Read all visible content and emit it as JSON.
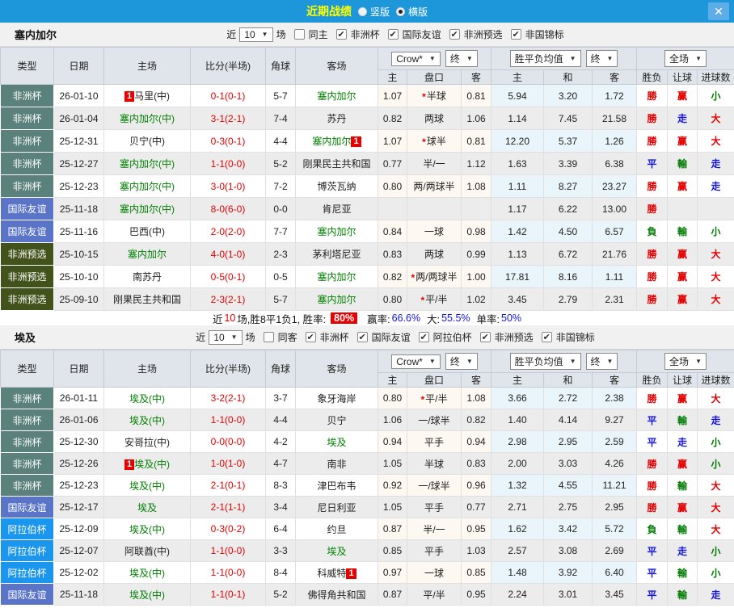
{
  "titlebar": {
    "title": "近期战绩",
    "radio_vertical": "竖版",
    "radio_horizontal": "横版",
    "selected_layout": "横版"
  },
  "icons": {
    "close": "✕",
    "check": "✔",
    "arrow": "▼",
    "star": "*",
    "badge_char": "1"
  },
  "columns": {
    "type": "类型",
    "date": "日期",
    "home": "主场",
    "score": "比分(半场)",
    "corner": "角球",
    "away": "客场",
    "sub": [
      "主",
      "盘口",
      "客",
      "主",
      "和",
      "客",
      "胜负",
      "让球",
      "进球数"
    ]
  },
  "dropdowns": {
    "crow": "Crow*",
    "final": "终",
    "avg": "胜平负均值",
    "full": "全场"
  },
  "type_styles": {
    "非洲杯": "#5a817b",
    "国际友谊": "#5a74c8",
    "非洲预选": "#41531a",
    "阿拉伯杯": "#1b96ee"
  },
  "result_colors": {
    "勝": "#e60000",
    "平": "#1414e6",
    "負": "#007a00",
    "赢": "#e60000",
    "輸": "#007a00",
    "走": "#1414e6",
    "大": "#e60000",
    "小": "#007a00"
  },
  "sections": [
    {
      "team": "塞内加尔",
      "filter": {
        "near": "近",
        "count": "10",
        "games": "场",
        "same_label": "同主",
        "same_checked": false,
        "cups": [
          "非洲杯",
          "国际友谊",
          "非洲预选",
          "非国锦标"
        ]
      },
      "summary": {
        "s1": "近",
        "count": "10",
        "s2": "场,胜8平1负1, 胜率:",
        "rate": "80%",
        "win_label": "赢率:",
        "win": "66.6%",
        "big_label": "大:",
        "big": "55.5%",
        "single_label": "单率:",
        "single": "50%"
      },
      "rows": [
        {
          "type": "非洲杯",
          "date": "26-01-10",
          "home": "马里(中)",
          "home_self": false,
          "home_badge": "pre",
          "score": "0-1(0-1)",
          "corner": "5-7",
          "away": "塞内加尔",
          "away_self": true,
          "o1": "1.07",
          "pk": "半球",
          "pk_star": true,
          "o2": "0.81",
          "a1": "5.94",
          "a2": "3.20",
          "a3": "1.72",
          "r1": "勝",
          "r2": "赢",
          "r3": "小"
        },
        {
          "type": "非洲杯",
          "date": "26-01-04",
          "home": "塞内加尔(中)",
          "home_self": true,
          "score": "3-1(2-1)",
          "corner": "7-4",
          "away": "苏丹",
          "away_self": false,
          "o1": "0.82",
          "pk": "两球",
          "o2": "1.06",
          "a1": "1.14",
          "a2": "7.45",
          "a3": "21.58",
          "r1": "勝",
          "r2": "走",
          "r3": "大"
        },
        {
          "type": "非洲杯",
          "date": "25-12-31",
          "home": "贝宁(中)",
          "home_self": false,
          "score": "0-3(0-1)",
          "corner": "4-4",
          "away": "塞内加尔",
          "away_self": true,
          "away_badge": "post",
          "o1": "1.07",
          "pk": "球半",
          "pk_star": true,
          "o2": "0.81",
          "a1": "12.20",
          "a2": "5.37",
          "a3": "1.26",
          "r1": "勝",
          "r2": "赢",
          "r3": "大"
        },
        {
          "type": "非洲杯",
          "date": "25-12-27",
          "home": "塞内加尔(中)",
          "home_self": true,
          "score": "1-1(0-0)",
          "corner": "5-2",
          "away": "刚果民主共和国",
          "away_self": false,
          "o1": "0.77",
          "pk": "半/一",
          "o2": "1.12",
          "a1": "1.63",
          "a2": "3.39",
          "a3": "6.38",
          "r1": "平",
          "r2": "輸",
          "r3": "走"
        },
        {
          "type": "非洲杯",
          "date": "25-12-23",
          "home": "塞内加尔(中)",
          "home_self": true,
          "score": "3-0(1-0)",
          "corner": "7-2",
          "away": "博茨瓦纳",
          "away_self": false,
          "o1": "0.80",
          "pk": "两/两球半",
          "o2": "1.08",
          "a1": "1.11",
          "a2": "8.27",
          "a3": "23.27",
          "r1": "勝",
          "r2": "赢",
          "r3": "走"
        },
        {
          "type": "国际友谊",
          "date": "25-11-18",
          "home": "塞内加尔(中)",
          "home_self": true,
          "score": "8-0(6-0)",
          "corner": "0-0",
          "away": "肯尼亚",
          "away_self": false,
          "o1": "",
          "pk": "",
          "o2": "",
          "a1": "1.17",
          "a2": "6.22",
          "a3": "13.00",
          "r1": "勝",
          "r2": "",
          "r3": ""
        },
        {
          "type": "国际友谊",
          "date": "25-11-16",
          "home": "巴西(中)",
          "home_self": false,
          "score": "2-0(2-0)",
          "corner": "7-7",
          "away": "塞内加尔",
          "away_self": true,
          "o1": "0.84",
          "pk": "一球",
          "o2": "0.98",
          "a1": "1.42",
          "a2": "4.50",
          "a3": "6.57",
          "r1": "負",
          "r2": "輸",
          "r3": "小"
        },
        {
          "type": "非洲预选",
          "date": "25-10-15",
          "home": "塞内加尔",
          "home_self": true,
          "score": "4-0(1-0)",
          "corner": "2-3",
          "away": "茅利塔尼亚",
          "away_self": false,
          "o1": "0.83",
          "pk": "两球",
          "o2": "0.99",
          "a1": "1.13",
          "a2": "6.72",
          "a3": "21.76",
          "r1": "勝",
          "r2": "赢",
          "r3": "大"
        },
        {
          "type": "非洲预选",
          "date": "25-10-10",
          "home": "南苏丹",
          "home_self": false,
          "score": "0-5(0-1)",
          "corner": "0-5",
          "away": "塞内加尔",
          "away_self": true,
          "o1": "0.82",
          "pk": "两/两球半",
          "pk_star": true,
          "o2": "1.00",
          "a1": "17.81",
          "a2": "8.16",
          "a3": "1.11",
          "r1": "勝",
          "r2": "赢",
          "r3": "大"
        },
        {
          "type": "非洲预选",
          "date": "25-09-10",
          "home": "刚果民主共和国",
          "home_self": false,
          "score": "2-3(2-1)",
          "corner": "5-7",
          "away": "塞内加尔",
          "away_self": true,
          "o1": "0.80",
          "pk": "平/半",
          "pk_star": true,
          "o2": "1.02",
          "a1": "3.45",
          "a2": "2.79",
          "a3": "2.31",
          "r1": "勝",
          "r2": "赢",
          "r3": "大"
        }
      ]
    },
    {
      "team": "埃及",
      "filter": {
        "near": "近",
        "count": "10",
        "games": "场",
        "same_label": "同客",
        "same_checked": false,
        "cups": [
          "非洲杯",
          "国际友谊",
          "阿拉伯杯",
          "非洲预选",
          "非国锦标"
        ]
      },
      "rows": [
        {
          "type": "非洲杯",
          "date": "26-01-11",
          "home": "埃及(中)",
          "home_self": true,
          "score": "3-2(2-1)",
          "corner": "3-7",
          "away": "象牙海岸",
          "away_self": false,
          "o1": "0.80",
          "pk": "平/半",
          "pk_star": true,
          "o2": "1.08",
          "a1": "3.66",
          "a2": "2.72",
          "a3": "2.38",
          "r1": "勝",
          "r2": "赢",
          "r3": "大"
        },
        {
          "type": "非洲杯",
          "date": "26-01-06",
          "home": "埃及(中)",
          "home_self": true,
          "score": "1-1(0-0)",
          "corner": "4-4",
          "away": "贝宁",
          "away_self": false,
          "o1": "1.06",
          "pk": "一/球半",
          "o2": "0.82",
          "a1": "1.40",
          "a2": "4.14",
          "a3": "9.27",
          "r1": "平",
          "r2": "輸",
          "r3": "走"
        },
        {
          "type": "非洲杯",
          "date": "25-12-30",
          "home": "安哥拉(中)",
          "home_self": false,
          "score": "0-0(0-0)",
          "corner": "4-2",
          "away": "埃及",
          "away_self": true,
          "o1": "0.94",
          "pk": "平手",
          "o2": "0.94",
          "a1": "2.98",
          "a2": "2.95",
          "a3": "2.59",
          "r1": "平",
          "r2": "走",
          "r3": "小"
        },
        {
          "type": "非洲杯",
          "date": "25-12-26",
          "home": "埃及(中)",
          "home_self": true,
          "home_badge": "pre",
          "score": "1-0(1-0)",
          "corner": "4-7",
          "away": "南非",
          "away_self": false,
          "o1": "1.05",
          "pk": "半球",
          "o2": "0.83",
          "a1": "2.00",
          "a2": "3.03",
          "a3": "4.26",
          "r1": "勝",
          "r2": "赢",
          "r3": "小"
        },
        {
          "type": "非洲杯",
          "date": "25-12-23",
          "home": "埃及(中)",
          "home_self": true,
          "score": "2-1(0-1)",
          "corner": "8-3",
          "away": "津巴布韦",
          "away_self": false,
          "o1": "0.92",
          "pk": "一/球半",
          "o2": "0.96",
          "a1": "1.32",
          "a2": "4.55",
          "a3": "11.21",
          "r1": "勝",
          "r2": "輸",
          "r3": "大"
        },
        {
          "type": "国际友谊",
          "date": "25-12-17",
          "home": "埃及",
          "home_self": true,
          "score": "2-1(1-1)",
          "corner": "3-4",
          "away": "尼日利亚",
          "away_self": false,
          "o1": "1.05",
          "pk": "平手",
          "o2": "0.77",
          "a1": "2.71",
          "a2": "2.75",
          "a3": "2.95",
          "r1": "勝",
          "r2": "赢",
          "r3": "大"
        },
        {
          "type": "阿拉伯杯",
          "date": "25-12-09",
          "home": "埃及(中)",
          "home_self": true,
          "score": "0-3(0-2)",
          "corner": "6-4",
          "away": "约旦",
          "away_self": false,
          "o1": "0.87",
          "pk": "半/一",
          "o2": "0.95",
          "a1": "1.62",
          "a2": "3.42",
          "a3": "5.72",
          "r1": "負",
          "r2": "輸",
          "r3": "大"
        },
        {
          "type": "阿拉伯杯",
          "date": "25-12-07",
          "home": "阿联酋(中)",
          "home_self": false,
          "score": "1-1(0-0)",
          "corner": "3-3",
          "away": "埃及",
          "away_self": true,
          "o1": "0.85",
          "pk": "平手",
          "o2": "1.03",
          "a1": "2.57",
          "a2": "3.08",
          "a3": "2.69",
          "r1": "平",
          "r2": "走",
          "r3": "小"
        },
        {
          "type": "阿拉伯杯",
          "date": "25-12-02",
          "home": "埃及(中)",
          "home_self": true,
          "score": "1-1(0-0)",
          "corner": "8-4",
          "away": "科威特",
          "away_self": false,
          "away_badge": "post",
          "o1": "0.97",
          "pk": "一球",
          "o2": "0.85",
          "a1": "1.48",
          "a2": "3.92",
          "a3": "6.40",
          "r1": "平",
          "r2": "輸",
          "r3": "小"
        },
        {
          "type": "国际友谊",
          "date": "25-11-18",
          "home": "埃及(中)",
          "home_self": true,
          "score": "1-1(0-1)",
          "corner": "5-2",
          "away": "佛得角共和国",
          "away_self": false,
          "o1": "0.87",
          "pk": "平/半",
          "o2": "0.95",
          "a1": "2.24",
          "a2": "3.01",
          "a3": "3.45",
          "r1": "平",
          "r2": "輸",
          "r3": "走"
        }
      ]
    }
  ]
}
